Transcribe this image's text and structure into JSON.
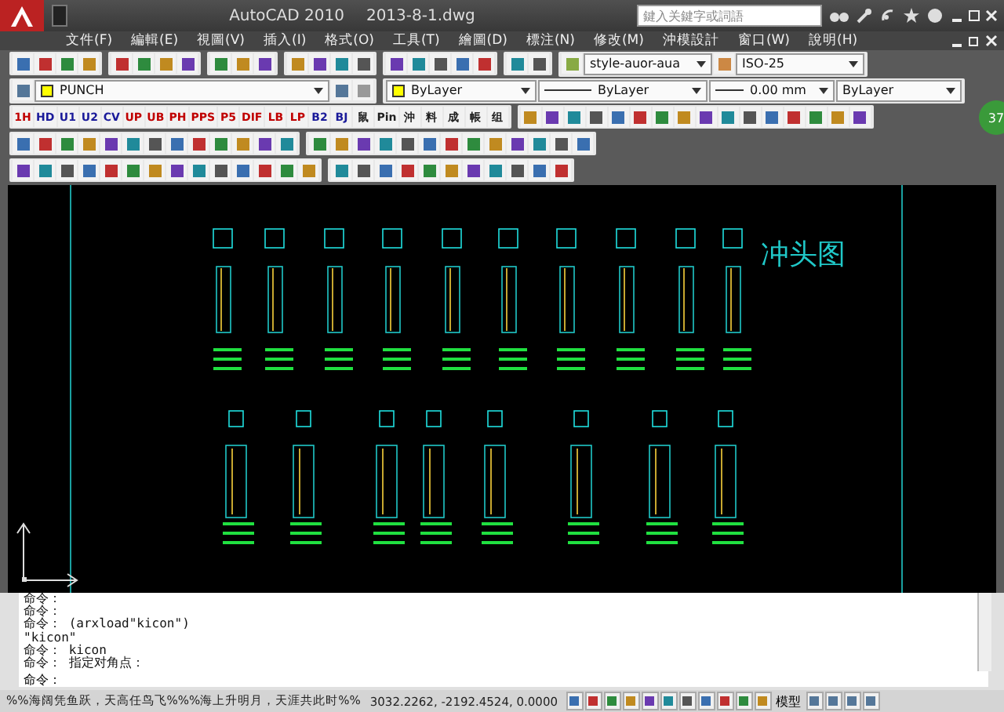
{
  "window": {
    "title": "AutoCAD 2010",
    "document": "2013-8-1.dwg"
  },
  "search": {
    "placeholder": "鍵入关鍵字或詞語"
  },
  "menu": [
    "文件(F)",
    "編輯(E)",
    "視圖(V)",
    "插入(I)",
    "格式(O)",
    "工具(T)",
    "繪圖(D)",
    "標注(N)",
    "修改(M)",
    "沖模設計",
    "窗口(W)",
    "說明(H)"
  ],
  "styles": {
    "text_style": "style-auor-aua",
    "dim_style": "ISO-25"
  },
  "properties": {
    "layer": "PUNCH",
    "color_setting": "ByLayer",
    "linetype": "ByLayer",
    "lineweight": "0.00 mm",
    "plot_style": "ByLayer"
  },
  "custom_tools": [
    {
      "label": "1H",
      "color": "#c00000"
    },
    {
      "label": "HD",
      "color": "#1a1a9a"
    },
    {
      "label": "U1",
      "color": "#1a1a9a"
    },
    {
      "label": "U2",
      "color": "#1a1a9a"
    },
    {
      "label": "CV",
      "color": "#1a1a9a"
    },
    {
      "label": "UP",
      "color": "#c00000"
    },
    {
      "label": "UB",
      "color": "#c00000"
    },
    {
      "label": "PH",
      "color": "#c00000"
    },
    {
      "label": "PPS",
      "color": "#c00000"
    },
    {
      "label": "P5",
      "color": "#c00000"
    },
    {
      "label": "DIF",
      "color": "#c00000"
    },
    {
      "label": "LB",
      "color": "#c00000"
    },
    {
      "label": "LP",
      "color": "#c00000"
    },
    {
      "label": "B2",
      "color": "#1a1a9a"
    },
    {
      "label": "BJ",
      "color": "#1a1a9a"
    },
    {
      "label": "鼠",
      "color": "#202020"
    },
    {
      "label": "Pin",
      "color": "#202020"
    },
    {
      "label": "沖",
      "color": "#202020"
    },
    {
      "label": "料",
      "color": "#202020"
    },
    {
      "label": "成",
      "color": "#202020"
    },
    {
      "label": "帳",
      "color": "#202020"
    },
    {
      "label": "组",
      "color": "#202020"
    }
  ],
  "drawing": {
    "title": "冲头图"
  },
  "notification": {
    "count": "37"
  },
  "command_history": [
    "命令：",
    "命令：",
    "命令： (arxload\"kicon\")",
    "\"kicon\"",
    "命令： kicon",
    "命令： 指定对角点："
  ],
  "command_prompt": "命令：",
  "status_bar": {
    "message": "%%海阔凭鱼跃，天高任鸟飞%%%海上升明月，天涯共此时%%",
    "coordinates": "3032.2262, -2192.4524, 0.0000",
    "space": "模型"
  }
}
